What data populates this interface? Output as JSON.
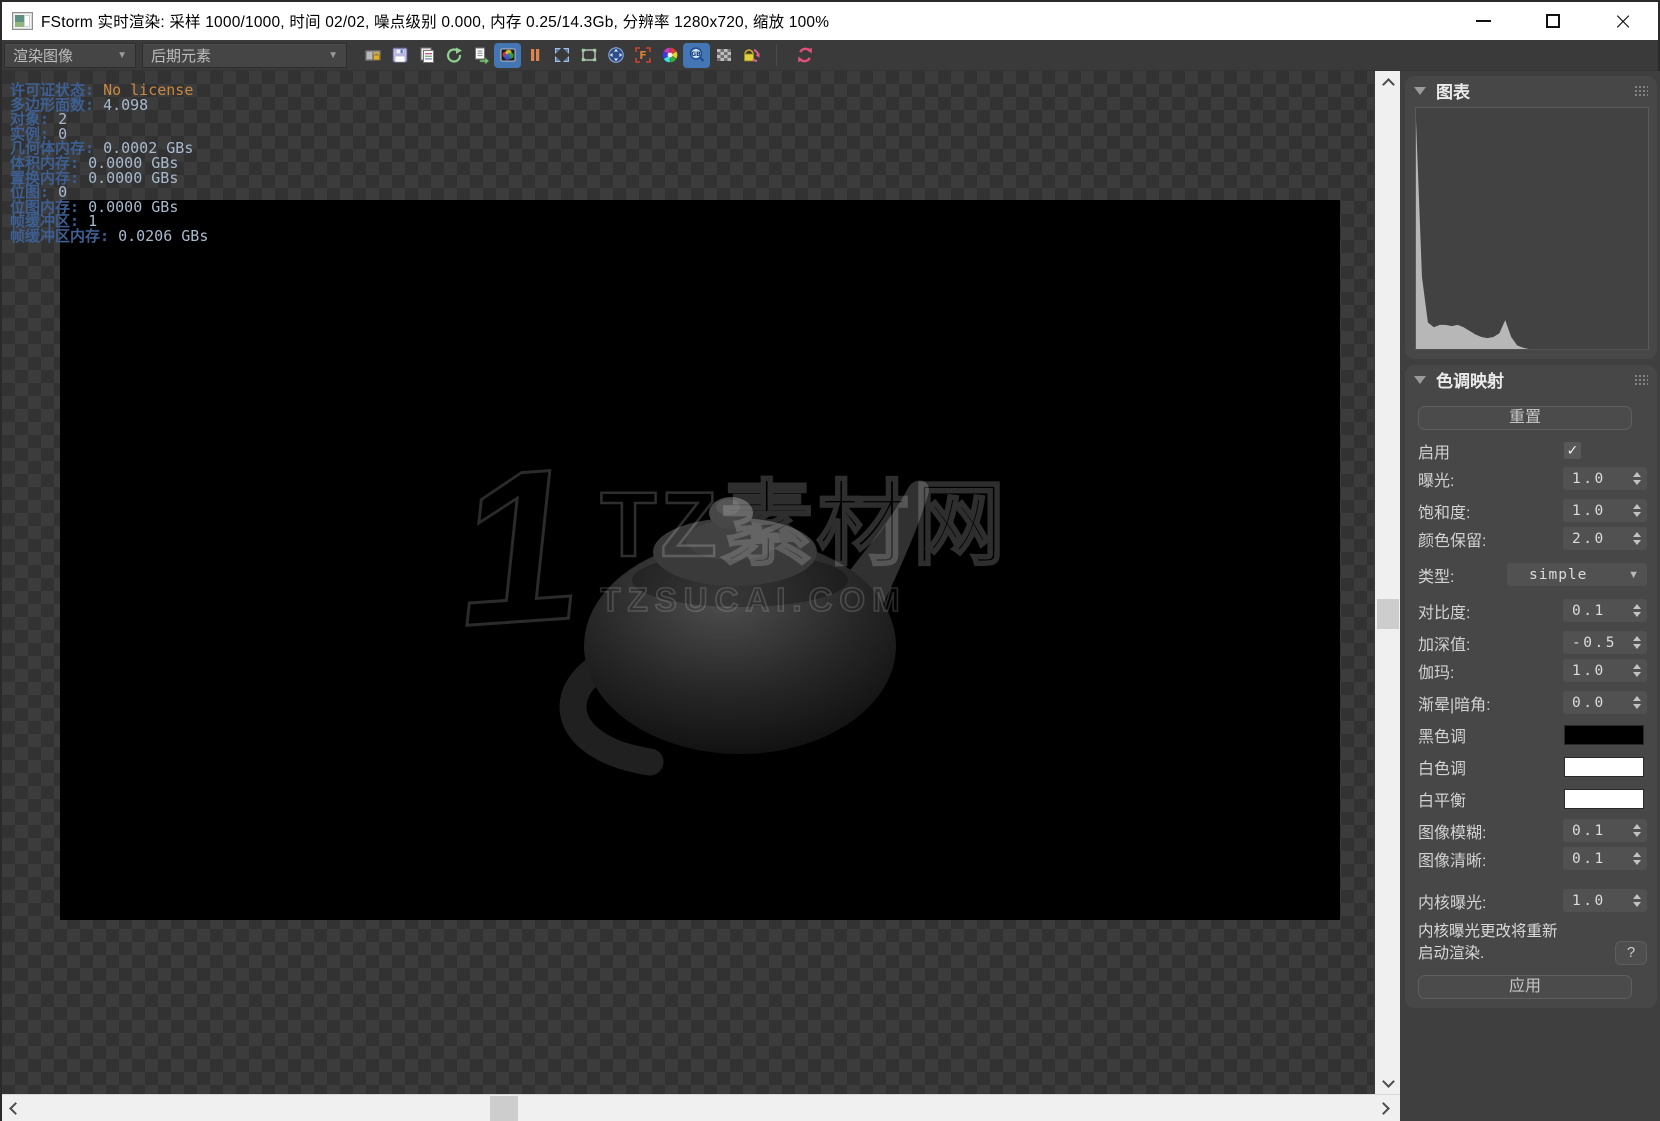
{
  "window": {
    "title": "FStorm 实时渲染: 采样 1000/1000, 时间 02/02, 噪点级别 0.000, 内存 0.25/14.3Gb, 分辨率 1280x720, 缩放 100%",
    "close_glyph": "×"
  },
  "toolbar": {
    "render_image_dropdown": "渲染图像",
    "post_elements_dropdown": "后期元素",
    "dropdown_arrow": "▼",
    "icons": [
      "lock-render",
      "save",
      "copy-image",
      "redo-history",
      "clone-buffer",
      "color-correction",
      "pause",
      "fit-view",
      "region-render",
      "panorama",
      "frame-f",
      "color-wheel",
      "zoom-gb",
      "alpha-checker",
      "lock-refresh",
      "refresh-render"
    ],
    "active_icons": [
      "color-correction",
      "zoom-gb"
    ],
    "active_color": "#4576b4"
  },
  "stats": {
    "label_color": "#3d5f93",
    "value_color": "#a9bacf",
    "license_value_color": "#c9873f",
    "lines": [
      {
        "label": "许可证状态:",
        "value": "No license"
      },
      {
        "label": "多边形面数:",
        "value": "4.098"
      },
      {
        "label": "对象:",
        "value": "2"
      },
      {
        "label": "实例:",
        "value": "0"
      },
      {
        "label": "几何体内存:",
        "value": "0.0002 GBs"
      },
      {
        "label": "体积内存:",
        "value": "0.0000 GBs"
      },
      {
        "label": "置换内存:",
        "value": "0.0000 GBs"
      },
      {
        "label": "位图:",
        "value": "0"
      },
      {
        "label": "位图内存:",
        "value": "0.0000 GBs"
      },
      {
        "label": "帧缓冲区:",
        "value": "1"
      },
      {
        "label": "帧缓冲区内存:",
        "value": "0.0206 GBs"
      }
    ]
  },
  "watermark": {
    "glyph": "1",
    "brand": "TZ素材网",
    "site": "TZSUCAI.COM"
  },
  "chart_data": {
    "type": "area",
    "title": "图表",
    "description": "render luminance histogram, left spike at black level",
    "x_range": [
      0,
      1
    ],
    "y_range": [
      0,
      1
    ],
    "grid": false,
    "legend": false,
    "fill_color": "#b7b7b7",
    "plot_bg": "#424242",
    "values": [
      0.95,
      0.3,
      0.11,
      0.09,
      0.1,
      0.1,
      0.095,
      0.1,
      0.09,
      0.075,
      0.06,
      0.05,
      0.045,
      0.05,
      0.065,
      0.12,
      0.05,
      0.015,
      0.005,
      0,
      0,
      0,
      0,
      0,
      0,
      0,
      0,
      0,
      0,
      0,
      0,
      0,
      0,
      0,
      0,
      0,
      0,
      0,
      0,
      0
    ]
  },
  "panel": {
    "chart_section_title": "图表",
    "tonemap": {
      "title": "色调映射",
      "reset_label": "重置",
      "checkmark": "✓",
      "rows": [
        {
          "label": "启用",
          "control": "checkbox",
          "checked": true
        },
        {
          "label": "曝光:",
          "value": "1.0"
        },
        {
          "label": "饱和度:",
          "value": "1.0"
        },
        {
          "label": "颜色保留:",
          "value": "2.0"
        },
        {
          "label": "类型:",
          "value": "simple",
          "control": "dropdown"
        },
        {
          "label": "对比度:",
          "value": "0.1"
        },
        {
          "label": "加深值:",
          "value": "-0.5"
        },
        {
          "label": "伽玛:",
          "value": "1.0"
        },
        {
          "label": "渐晕|暗角:",
          "value": "0.0"
        },
        {
          "label": "黑色调",
          "control": "swatch",
          "color": "#000000"
        },
        {
          "label": "白色调",
          "control": "swatch",
          "color": "#ffffff"
        },
        {
          "label": "白平衡",
          "control": "swatch",
          "color": "#ffffff"
        },
        {
          "label": "图像模糊:",
          "value": "0.1"
        },
        {
          "label": "图像清晰:",
          "value": "0.1"
        },
        {
          "label": "内核曝光:",
          "value": "1.0"
        }
      ],
      "kernel_note_line1": "内核曝光更改将重新",
      "kernel_note_line2": "启动渲染.",
      "help_label": "?",
      "apply_label": "应用"
    }
  }
}
